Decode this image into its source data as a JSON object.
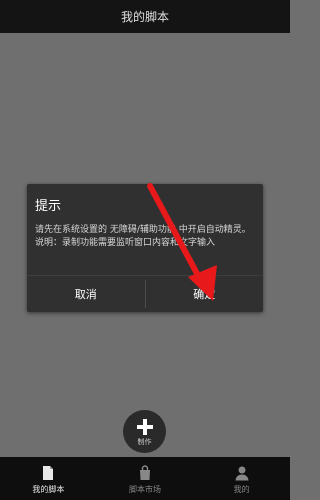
{
  "header": {
    "title": "我的脚本"
  },
  "dialog": {
    "title": "提示",
    "message_line1": "请先在系统设置的 无障碍/辅助功能 中开启自动精灵。",
    "message_line2": "说明：录制功能需要监听窗口内容和文字输入",
    "cancel_label": "取消",
    "confirm_label": "确定"
  },
  "fab": {
    "label": "制作"
  },
  "tabs": [
    {
      "label": "我的脚本",
      "icon": "document-icon",
      "active": true
    },
    {
      "label": "脚本市场",
      "icon": "bag-icon",
      "active": false
    },
    {
      "label": "我的",
      "icon": "person-icon",
      "active": false
    }
  ],
  "colors": {
    "background": "#6f6f6f",
    "dialog": "#303030",
    "arrow": "#e8191b",
    "tab_bar": "#0e0e0e"
  }
}
